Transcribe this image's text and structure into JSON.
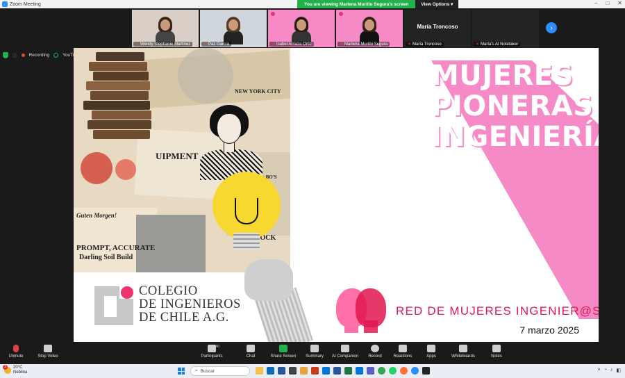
{
  "window": {
    "title": "Zoom Meeting"
  },
  "share_banner": {
    "viewing": "You are viewing Marlena Murillo Segura's screen",
    "options": "View Options"
  },
  "participants": [
    {
      "name": "Wendy Stephanie Martínez",
      "kind": "video"
    },
    {
      "name": "Paz García",
      "kind": "video"
    },
    {
      "name": "Isabel Arriaza Ortiz",
      "kind": "video-pink"
    },
    {
      "name": "Marlena Murillo Segura",
      "kind": "video-pink"
    },
    {
      "name": "María Troncoso",
      "kind": "name",
      "display": "María Troncoso"
    },
    {
      "name": "María's AI Notetaker",
      "kind": "notetaker"
    }
  ],
  "status": {
    "recording": "Recording",
    "youtube": "YouTube"
  },
  "slide": {
    "title_lines": [
      "MUJERES",
      "PIONERAS EN",
      "INGENIERÍA"
    ],
    "collage_texts": [
      "UIPMENT",
      "PROMPT, ACCURATE",
      "Darling Soil Build",
      "Guten Morgen!",
      "LIVESTOCK",
      "NEW YORK CITY",
      "Sold for the BO'S"
    ],
    "cig_lines": [
      "COLEGIO",
      "DE INGENIEROS",
      "DE CHILE A.G."
    ],
    "rdm_label": "RED DE MUJERES INGENIER@S",
    "date": "7 marzo 2025",
    "accent": "#f58ac6"
  },
  "toolbar": [
    {
      "label": "Unmute",
      "icon": "microphone-muted-icon"
    },
    {
      "label": "Stop Video",
      "icon": "video-camera-icon"
    },
    {
      "label": "Participants",
      "icon": "participants-icon",
      "count": "40"
    },
    {
      "label": "Chat",
      "icon": "chat-icon"
    },
    {
      "label": "Share Screen",
      "icon": "share-screen-icon"
    },
    {
      "label": "Summary",
      "icon": "summary-icon"
    },
    {
      "label": "AI Companion",
      "icon": "ai-companion-icon"
    },
    {
      "label": "Record",
      "icon": "record-icon"
    },
    {
      "label": "Reactions",
      "icon": "reactions-icon"
    },
    {
      "label": "Apps",
      "icon": "apps-icon"
    },
    {
      "label": "Whiteboards",
      "icon": "whiteboard-icon"
    },
    {
      "label": "Notes",
      "icon": "notes-icon"
    }
  ],
  "taskbar": {
    "weather_temp": "20°C",
    "weather_desc": "Neblina",
    "weather_badge": "3",
    "search_placeholder": "Buscar"
  }
}
